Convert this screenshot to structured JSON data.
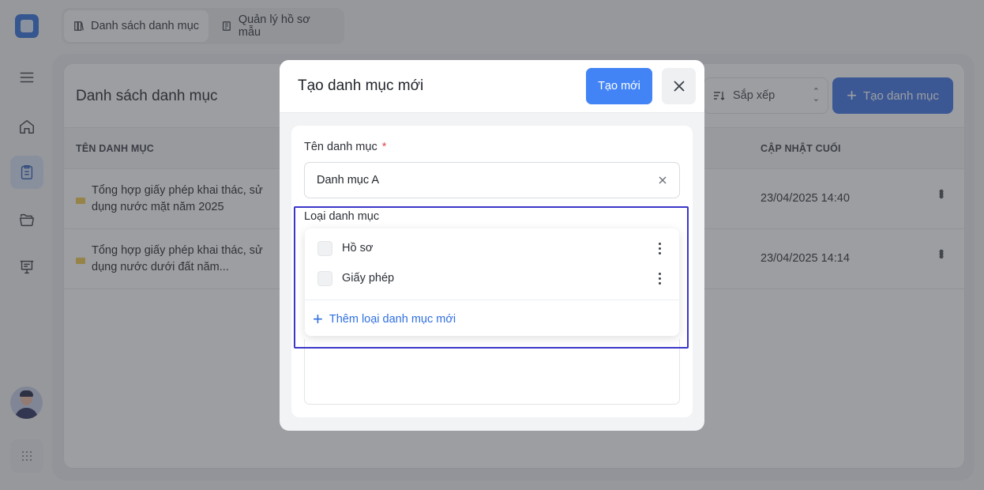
{
  "top_tabs": [
    {
      "label": "Danh sách danh mục",
      "active": true
    },
    {
      "label": "Quản lý hồ sơ mẫu",
      "active": false
    }
  ],
  "sidebar": {
    "items": [
      {
        "icon": "menu-icon"
      },
      {
        "icon": "home-icon"
      },
      {
        "icon": "clipboard-icon",
        "active": true
      },
      {
        "icon": "folders-icon"
      },
      {
        "icon": "presentation-icon"
      }
    ]
  },
  "page": {
    "title": "Danh sách danh mục",
    "sort_label": "Sắp xếp",
    "create_label": "Tạo danh mục",
    "columns": {
      "name": "TÊN DANH MỤC",
      "updated": "CẬP NHẬT CUỐI"
    },
    "rows": [
      {
        "name": "Tổng hợp giấy phép khai thác, sử dụng nước mặt năm 2025",
        "updated": "23/04/2025 14:40"
      },
      {
        "name": "Tổng hợp giấy phép khai thác, sử dụng nước dưới đất năm...",
        "updated": "23/04/2025 14:14"
      }
    ]
  },
  "modal": {
    "title": "Tạo danh mục mới",
    "submit_label": "Tạo mới",
    "name_field": {
      "label": "Tên danh mục",
      "required_mark": "*",
      "value": "Danh mục A"
    },
    "type_field": {
      "label": "Loại danh mục"
    },
    "type_options": [
      {
        "label": "Hồ sơ",
        "checked": false
      },
      {
        "label": "Giấy phép",
        "checked": false
      }
    ],
    "add_type_label": "Thêm loại danh mục mới"
  },
  "colors": {
    "primary": "#4284f5",
    "highlight": "#3b37c9",
    "required": "#e5484d"
  }
}
